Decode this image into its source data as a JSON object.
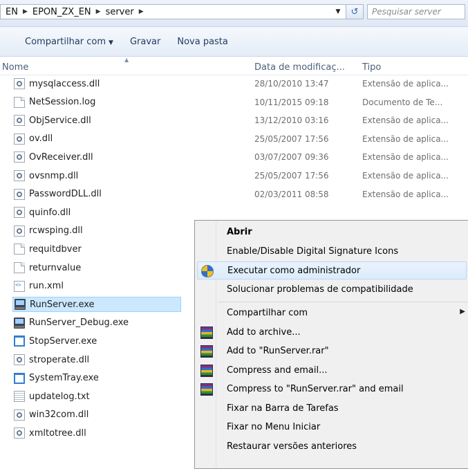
{
  "address": {
    "crumbs": [
      "EN",
      "EPON_ZX_EN",
      "server"
    ],
    "search_placeholder": "Pesquisar server"
  },
  "toolbar": {
    "share_label": "Compartilhar com",
    "burn_label": "Gravar",
    "new_folder_label": "Nova pasta"
  },
  "columns": {
    "name": "Nome",
    "date": "Data de modificaç...",
    "type": "Tipo"
  },
  "files": [
    {
      "name": "mysqlaccess.dll",
      "icon": "dll-icon",
      "date": "28/10/2010 13:47",
      "type": "Extensão de aplica..."
    },
    {
      "name": "NetSession.log",
      "icon": "document-icon",
      "date": "10/11/2015 09:18",
      "type": "Documento de Te..."
    },
    {
      "name": "ObjService.dll",
      "icon": "dll-icon",
      "date": "13/12/2010 03:16",
      "type": "Extensão de aplica..."
    },
    {
      "name": "ov.dll",
      "icon": "dll-icon",
      "date": "25/05/2007 17:56",
      "type": "Extensão de aplica..."
    },
    {
      "name": "OvReceiver.dll",
      "icon": "dll-icon",
      "date": "03/07/2007 09:36",
      "type": "Extensão de aplica..."
    },
    {
      "name": "ovsnmp.dll",
      "icon": "dll-icon",
      "date": "25/05/2007 17:56",
      "type": "Extensão de aplica..."
    },
    {
      "name": "PasswordDLL.dll",
      "icon": "dll-icon",
      "date": "02/03/2011 08:58",
      "type": "Extensão de aplica..."
    },
    {
      "name": "quinfo.dll",
      "icon": "dll-icon",
      "date": "",
      "type": ""
    },
    {
      "name": "rcwsping.dll",
      "icon": "dll-icon",
      "date": "",
      "type": ""
    },
    {
      "name": "requitdbver",
      "icon": "document-icon",
      "date": "",
      "type": ""
    },
    {
      "name": "returnvalue",
      "icon": "document-icon",
      "date": "",
      "type": ""
    },
    {
      "name": "run.xml",
      "icon": "xml-icon",
      "date": "",
      "type": ""
    },
    {
      "name": "RunServer.exe",
      "icon": "exe-icon",
      "date": "",
      "type": "",
      "selected": true
    },
    {
      "name": "RunServer_Debug.exe",
      "icon": "exe-icon",
      "date": "",
      "type": ""
    },
    {
      "name": "StopServer.exe",
      "icon": "window-icon",
      "date": "",
      "type": ""
    },
    {
      "name": "stroperate.dll",
      "icon": "dll-icon",
      "date": "",
      "type": ""
    },
    {
      "name": "SystemTray.exe",
      "icon": "window-icon",
      "date": "",
      "type": ""
    },
    {
      "name": "updatelog.txt",
      "icon": "text-file-icon",
      "date": "",
      "type": ""
    },
    {
      "name": "win32com.dll",
      "icon": "dll-icon",
      "date": "",
      "type": ""
    },
    {
      "name": "xmltotree.dll",
      "icon": "dll-icon",
      "date": "",
      "type": ""
    }
  ],
  "context_menu": {
    "items": [
      {
        "label": "Abrir",
        "bold": true
      },
      {
        "label": "Enable/Disable Digital Signature Icons"
      },
      {
        "label": "Executar como administrador",
        "icon": "uac-shield-icon",
        "highlighted": true
      },
      {
        "label": "Solucionar problemas de compatibilidade",
        "separator_after": true
      },
      {
        "label": "Compartilhar com",
        "submenu": true
      },
      {
        "label": "Add to archive...",
        "icon": "winrar-icon"
      },
      {
        "label": "Add to \"RunServer.rar\"",
        "icon": "winrar-icon"
      },
      {
        "label": "Compress and email...",
        "icon": "winrar-icon"
      },
      {
        "label": "Compress to \"RunServer.rar\" and email",
        "icon": "winrar-icon"
      },
      {
        "label": "Fixar na Barra de Tarefas"
      },
      {
        "label": "Fixar no Menu Iniciar"
      },
      {
        "label": "Restaurar versões anteriores"
      }
    ]
  }
}
